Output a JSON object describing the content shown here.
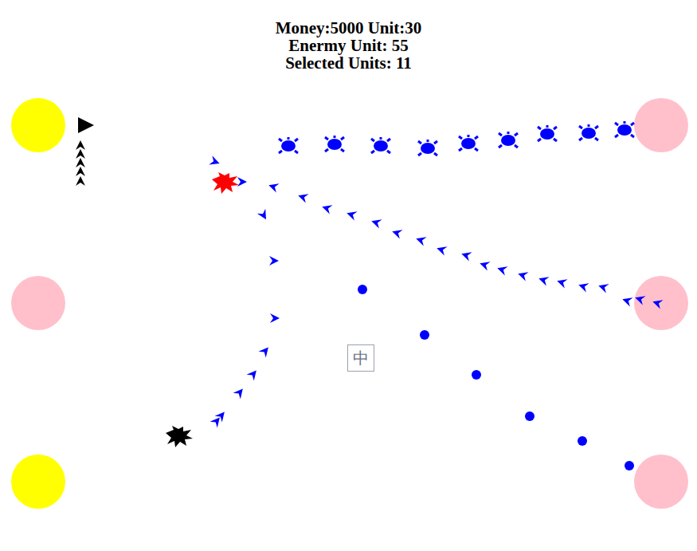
{
  "hud": {
    "money_line": "Money:5000 Unit:30",
    "enemy_line": "Enermy Unit: 55",
    "selected_line": "Selected Units: 11"
  },
  "bases": [
    {
      "color": "#ffff00"
    },
    {
      "color": "#ffc0cb"
    },
    {
      "color": "#ffff00"
    },
    {
      "color": "#ffc0cb"
    },
    {
      "color": "#ffc0cb"
    },
    {
      "color": "#ffc0cb"
    }
  ],
  "unit_groups": [
    {
      "kind": "tank",
      "color": "#0000ff",
      "selected": false,
      "count": 9
    },
    {
      "kind": "arrow",
      "color": "#0000ff",
      "selected": false,
      "count": 19
    },
    {
      "kind": "arrow",
      "color": "#0000ff",
      "selected": false,
      "count": 8
    },
    {
      "kind": "dot",
      "color": "#0000ff",
      "selected": false,
      "count": 6
    },
    {
      "kind": "arrow",
      "color": "#0000ff",
      "selected": false,
      "count": 2
    },
    {
      "kind": "cluster",
      "color": "#ff0000",
      "selected": true,
      "count": 1
    },
    {
      "kind": "cluster",
      "color": "#000000",
      "selected": false,
      "count": 1
    },
    {
      "kind": "flag",
      "color": "#000000",
      "selected": false,
      "count": 1
    },
    {
      "kind": "arrow",
      "color": "#000000",
      "selected": false,
      "count": 5
    }
  ],
  "ime_indicator": "中"
}
